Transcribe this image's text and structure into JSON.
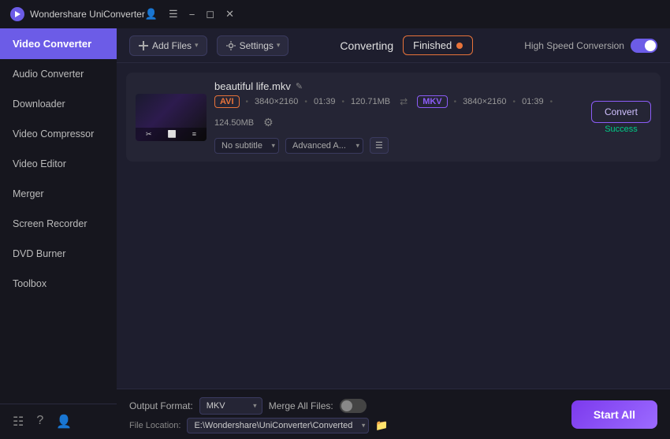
{
  "app": {
    "title": "Wondershare UniConverter",
    "logo_alt": "Wondershare Logo"
  },
  "titlebar": {
    "controls": [
      "user-icon",
      "menu-icon",
      "minimize-icon",
      "maximize-icon",
      "close-icon"
    ]
  },
  "sidebar": {
    "active": "Video Converter",
    "items": [
      {
        "id": "video-converter",
        "label": "Video Converter",
        "active": true
      },
      {
        "id": "audio-converter",
        "label": "Audio Converter"
      },
      {
        "id": "downloader",
        "label": "Downloader"
      },
      {
        "id": "video-compressor",
        "label": "Video Compressor"
      },
      {
        "id": "video-editor",
        "label": "Video Editor"
      },
      {
        "id": "merger",
        "label": "Merger"
      },
      {
        "id": "screen-recorder",
        "label": "Screen Recorder"
      },
      {
        "id": "dvd-burner",
        "label": "DVD Burner"
      },
      {
        "id": "toolbox",
        "label": "Toolbox"
      }
    ],
    "bottom_icons": [
      "layout-icon",
      "help-icon",
      "user-profile-icon"
    ]
  },
  "toolbar": {
    "add_files_label": "Add Files",
    "add_files_dropdown": true,
    "settings_label": "Settings",
    "converting_label": "Converting",
    "finished_label": "Finished",
    "high_speed_label": "High Speed Conversion"
  },
  "file_item": {
    "filename": "beautiful life.mkv",
    "input_format": "AVI",
    "input_resolution": "3840×2160",
    "input_duration": "01:39",
    "input_size": "120.71MB",
    "output_format": "MKV",
    "output_resolution": "3840×2160",
    "output_duration": "01:39",
    "output_size": "124.50MB",
    "subtitle_placeholder": "No subtitle",
    "advanced_placeholder": "Advanced A...",
    "convert_btn_label": "Convert",
    "success_label": "Success"
  },
  "bottom_bar": {
    "output_format_label": "Output Format:",
    "output_format_value": "MKV",
    "merge_label": "Merge All Files:",
    "file_location_label": "File Location:",
    "file_location_path": "E:\\Wondershare\\UniConverter\\Converted",
    "start_all_label": "Start All"
  }
}
